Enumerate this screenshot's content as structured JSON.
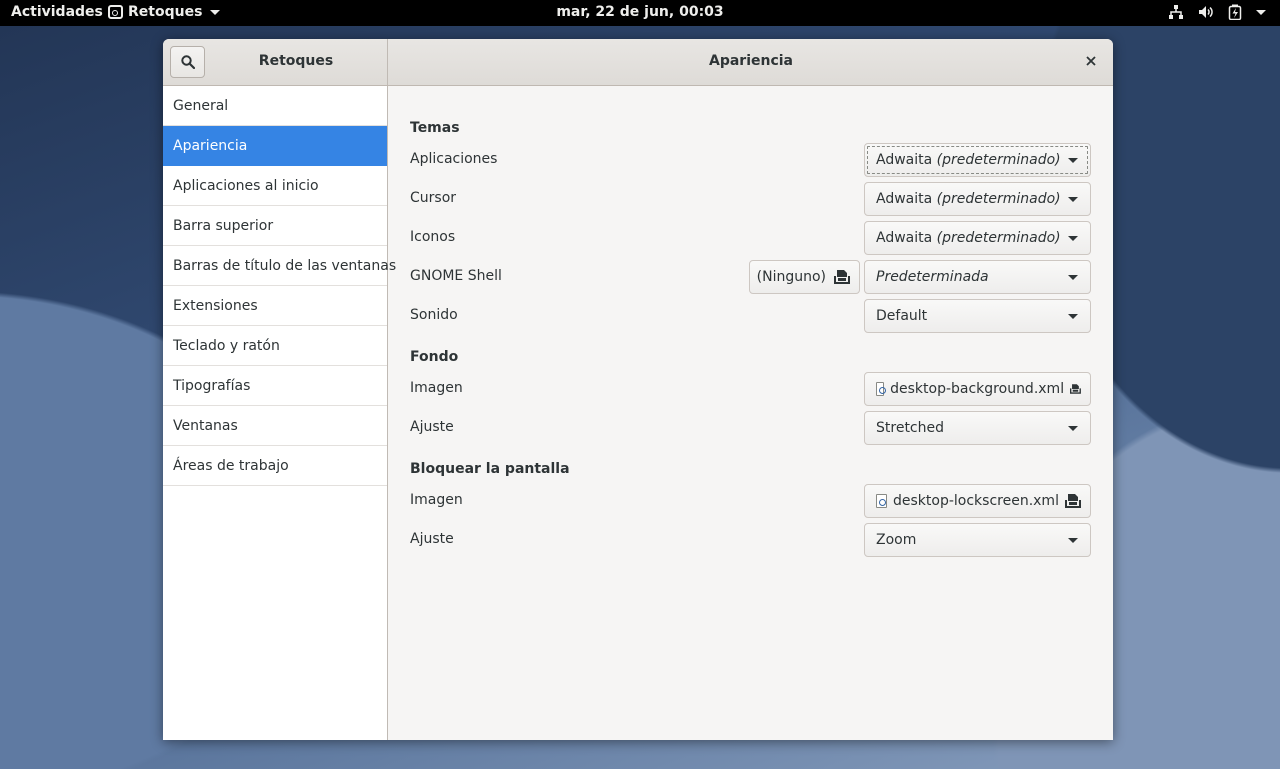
{
  "topbar": {
    "activities": "Actividades",
    "app_name": "Retoques",
    "clock": "mar, 22 de jun, 00:03",
    "tray_icons": [
      "network-icon",
      "volume-icon",
      "battery-icon",
      "system-menu-caret-icon"
    ]
  },
  "window": {
    "sidebar_title": "Retoques",
    "title": "Apariencia",
    "search_icon": "search-icon",
    "close_icon": "close-icon"
  },
  "sidebar": {
    "items": [
      {
        "label": "General"
      },
      {
        "label": "Apariencia",
        "active": true
      },
      {
        "label": "Aplicaciones al inicio"
      },
      {
        "label": "Barra superior"
      },
      {
        "label": "Barras de título de las ventanas"
      },
      {
        "label": "Extensiones"
      },
      {
        "label": "Teclado y ratón"
      },
      {
        "label": "Tipografías"
      },
      {
        "label": "Ventanas"
      },
      {
        "label": "Áreas de trabajo"
      }
    ]
  },
  "temas": {
    "title": "Temas",
    "aplicaciones": {
      "label": "Aplicaciones",
      "value_name": "Adwaita",
      "value_note": "(predeterminado)"
    },
    "cursor": {
      "label": "Cursor",
      "value_name": "Adwaita",
      "value_note": "(predeterminado)"
    },
    "iconos": {
      "label": "Iconos",
      "value_name": "Adwaita",
      "value_note": "(predeterminado)"
    },
    "shell": {
      "label": "GNOME Shell",
      "file_label": "(Ninguno)",
      "value": "Predeterminada"
    },
    "sonido": {
      "label": "Sonido",
      "value": "Default"
    }
  },
  "fondo": {
    "title": "Fondo",
    "imagen": {
      "label": "Imagen",
      "file": "desktop-background.xml"
    },
    "ajuste": {
      "label": "Ajuste",
      "value": "Stretched"
    }
  },
  "bloqueo": {
    "title": "Bloquear la pantalla",
    "imagen": {
      "label": "Imagen",
      "file": "desktop-lockscreen.xml"
    },
    "ajuste": {
      "label": "Ajuste",
      "value": "Zoom"
    }
  },
  "colors": {
    "accent": "#3584e4",
    "topbar_bg": "#000000",
    "window_bg": "#f6f5f4"
  }
}
